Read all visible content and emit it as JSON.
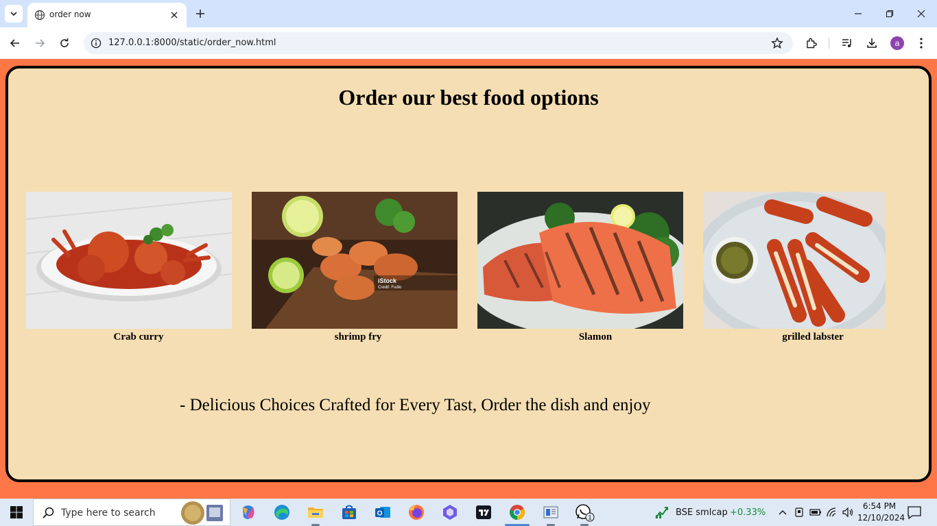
{
  "browser": {
    "tab_title": "order now",
    "url": "127.0.0.1:8000/static/order_now.html",
    "profile_initial": "a"
  },
  "page": {
    "heading": "Order our best food options",
    "items": [
      {
        "name": "Crab curry",
        "image": "crab-curry-photo"
      },
      {
        "name": "shrimp fry",
        "image": "shrimp-fry-photo"
      },
      {
        "name": "Slamon",
        "image": "salmon-photo"
      },
      {
        "name": "grilled labster",
        "image": "grilled-lobster-photo"
      }
    ],
    "tagline": "- Delicious Choices Crafted for Every Tast, Order the dish and enjoy",
    "colors": {
      "background": "#ff7747",
      "card": "#f5deb3",
      "border": "#000000"
    }
  },
  "taskbar": {
    "search_placeholder": "Type here to search",
    "stock_name": "BSE smlcap",
    "stock_change": "+0.33%",
    "time": "6:54 PM",
    "date": "12/10/2024",
    "whatsapp_badge": "1"
  }
}
